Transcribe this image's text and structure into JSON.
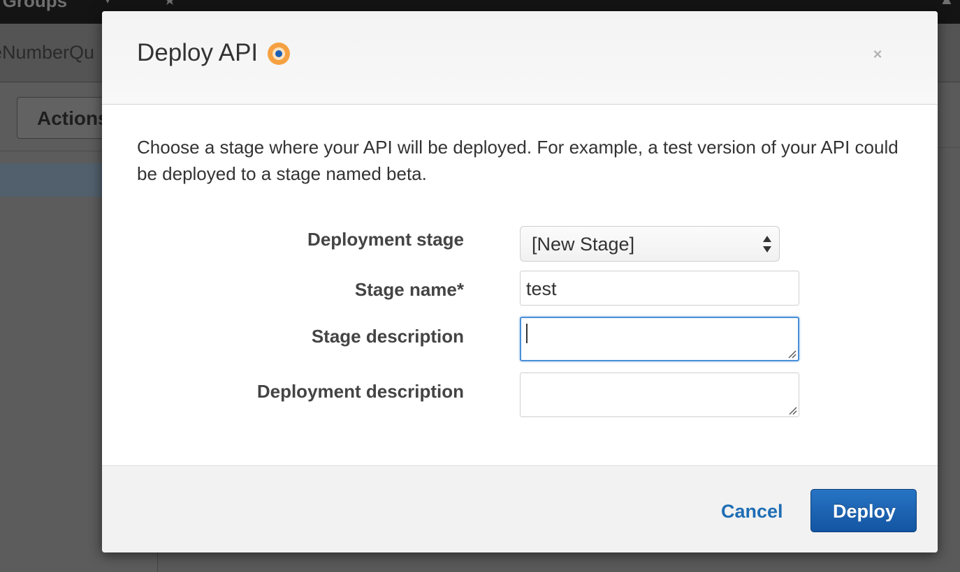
{
  "background": {
    "topbar_text": "e Groups",
    "api_name": "eNumberQu",
    "actions_label": "Actions"
  },
  "modal": {
    "title": "Deploy API",
    "intro": "Choose a stage where your API will be deployed. For example, a test version of your API could be deployed to a stage named beta.",
    "fields": {
      "deployment_stage": {
        "label": "Deployment stage",
        "value": "[New Stage]"
      },
      "stage_name": {
        "label": "Stage name*",
        "value": "test"
      },
      "stage_description": {
        "label": "Stage description",
        "value": ""
      },
      "deployment_description": {
        "label": "Deployment description",
        "value": ""
      }
    },
    "footer": {
      "cancel_label": "Cancel",
      "deploy_label": "Deploy"
    },
    "close_symbol": "×"
  },
  "icons": {
    "info": "info-icon",
    "close": "close-icon",
    "select_arrows": "select-arrows-icon",
    "resize": "resize-grip-icon"
  },
  "colors": {
    "primary_button": "#1f62ab",
    "link": "#1f6db5",
    "focus_border": "#4a8fd6",
    "info_icon_outer": "#f5a142",
    "info_icon_inner": "#1a5fb4"
  }
}
